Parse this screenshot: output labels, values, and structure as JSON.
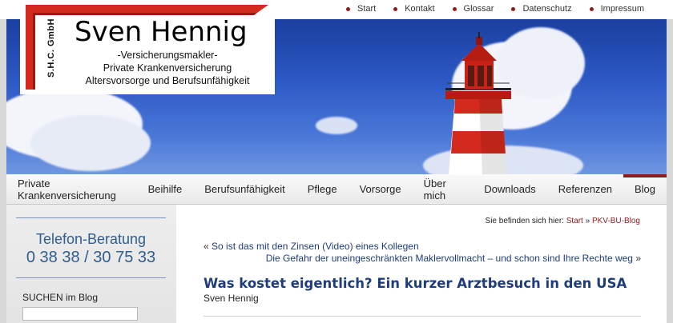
{
  "topnav": [
    {
      "label": "Start"
    },
    {
      "label": "Kontakt"
    },
    {
      "label": "Glossar"
    },
    {
      "label": "Datenschutz"
    },
    {
      "label": "Impressum"
    }
  ],
  "logo": {
    "vertical": "S.H.C. GmbH",
    "name": "Sven Hennig",
    "line1": "-Versicherungsmakler-",
    "line2": "Private Krankenversicherung",
    "line3": "Altersvorsorge und Berufsunfähigkeit"
  },
  "mainnav": [
    {
      "label": "Private Krankenversicherung"
    },
    {
      "label": "Beihilfe"
    },
    {
      "label": "Berufsunfähigkeit"
    },
    {
      "label": "Pflege"
    },
    {
      "label": "Vorsorge"
    },
    {
      "label": "Über mich"
    },
    {
      "label": "Downloads"
    },
    {
      "label": "Referenzen"
    },
    {
      "label": "Blog",
      "active": true
    }
  ],
  "sidebar": {
    "tel_title": "Telefon-Beratung",
    "tel_number": "0 38 38 / 30 75 33",
    "search_label": "SUCHEN im Blog"
  },
  "breadcrumb": {
    "prefix": "Sie befinden sich hier:",
    "start": "Start",
    "separator": "»",
    "current": "PKV-BU-Blog"
  },
  "post_nav": {
    "prev_arrow": "«",
    "prev": "So ist das mit den Zinsen (Video) eines Kollegen",
    "next": "Die Gefahr der uneingeschränkten Maklervollmacht – und schon sind Ihre Rechte weg",
    "next_arrow": "»"
  },
  "post": {
    "title": "Was kostet eigentlich? Ein kurzer Arztbesuch in den USA",
    "author": "Sven Hennig"
  },
  "colors": {
    "accent": "#8b1c1c",
    "link": "#1f3d7a",
    "phone": "#2f5e8f"
  }
}
